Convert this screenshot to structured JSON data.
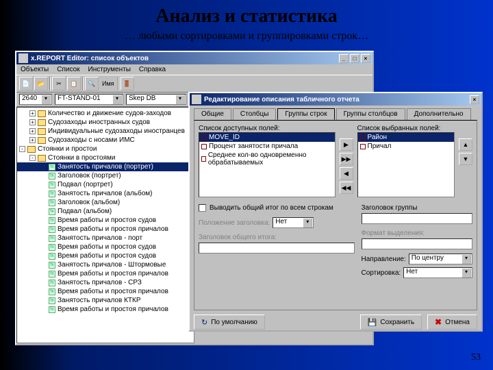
{
  "slide": {
    "title": "Анализ и статистика",
    "subtitle": "… любыми сортировками и группировками строк…",
    "page": "53"
  },
  "editor": {
    "title": "x.REPORT Editor: список объектов",
    "menu": [
      "Объекты",
      "Список",
      "Инструменты",
      "Справка"
    ],
    "filter1": "2640",
    "filter2": "FT-STAND-01",
    "filter3": "Skep DB",
    "tree": [
      {
        "ind": 1,
        "exp": "+",
        "kind": "folder",
        "label": "Количество и движение судов-заходов"
      },
      {
        "ind": 1,
        "exp": "+",
        "kind": "folder",
        "label": "Судозаходы иностранных судов"
      },
      {
        "ind": 1,
        "exp": "+",
        "kind": "folder",
        "label": "Индивидуальные судозаходы иностранцев"
      },
      {
        "ind": 1,
        "exp": "+",
        "kind": "folder",
        "label": "Судозаходы с носами ИМС"
      },
      {
        "ind": 0,
        "exp": "-",
        "kind": "folder",
        "label": "Стоянки и простои"
      },
      {
        "ind": 1,
        "exp": "-",
        "kind": "folder",
        "label": "Стоянки в простоями"
      },
      {
        "ind": 2,
        "exp": "",
        "kind": "rpt",
        "label": "Занятость причалов (портрет)",
        "sel": true
      },
      {
        "ind": 2,
        "exp": "",
        "kind": "rpt",
        "label": "Заголовок (портрет)"
      },
      {
        "ind": 2,
        "exp": "",
        "kind": "rpt",
        "label": "Подвал (портрет)"
      },
      {
        "ind": 2,
        "exp": "",
        "kind": "rpt",
        "label": "Занятость причалов (альбом)"
      },
      {
        "ind": 2,
        "exp": "",
        "kind": "rpt",
        "label": "Заголовок (альбом)"
      },
      {
        "ind": 2,
        "exp": "",
        "kind": "rpt",
        "label": "Подвал (альбом)"
      },
      {
        "ind": 2,
        "exp": "",
        "kind": "rpt",
        "label": "Время работы и простоя судов"
      },
      {
        "ind": 2,
        "exp": "",
        "kind": "rpt",
        "label": "Время работы и простоя причалов"
      },
      {
        "ind": 2,
        "exp": "",
        "kind": "rpt",
        "label": "Занятость причалов - порт"
      },
      {
        "ind": 2,
        "exp": "",
        "kind": "rpt",
        "label": "Время работы и простоя судов"
      },
      {
        "ind": 2,
        "exp": "",
        "kind": "rpt",
        "label": "Время работы и простоя судов"
      },
      {
        "ind": 2,
        "exp": "",
        "kind": "rpt",
        "label": "Занятость причалов - Штормовые"
      },
      {
        "ind": 2,
        "exp": "",
        "kind": "rpt",
        "label": "Время работы и простоя причалов"
      },
      {
        "ind": 2,
        "exp": "",
        "kind": "rpt",
        "label": "Занятость причалов - СРЗ"
      },
      {
        "ind": 2,
        "exp": "",
        "kind": "rpt",
        "label": "Время работы и простоя причалов"
      },
      {
        "ind": 2,
        "exp": "",
        "kind": "rpt",
        "label": "Занятость причалов КТКР"
      },
      {
        "ind": 2,
        "exp": "",
        "kind": "rpt",
        "label": "Время работы и простоя причалов"
      }
    ]
  },
  "dialog": {
    "title": "Редактирование описания табличного отчета",
    "tabs": [
      "Общие",
      "Столбцы",
      "Группы строк",
      "Группы столбцов",
      "Дополнительно"
    ],
    "active_tab": 2,
    "left_label": "Список доступных полей:",
    "right_label": "Список выбранных полей:",
    "avail": [
      {
        "label": "MOVE_ID",
        "sel": true
      },
      {
        "label": "Процент занятости причала"
      },
      {
        "label": "Среднее кол-во одновременно обрабатываемых"
      }
    ],
    "picked": [
      {
        "label": "Район",
        "sel": true
      },
      {
        "label": "Причал"
      }
    ],
    "chk_total": "Выводить общий итог по всем строкам",
    "group_header_lbl": "Заголовок группы",
    "itog_pos_lbl": "Положение заголовка:",
    "itog_pos_val": "Нет",
    "total_header_lbl": "Заголовок общего итога:",
    "format_lbl": "Формат выделения:",
    "dir_lbl": "Направление:",
    "dir_val": "По центру",
    "sort_lbl": "Сортировка:",
    "sort_val": "Нет",
    "btn_default": "По умолчанию",
    "btn_save": "Сохранить",
    "btn_cancel": "Отмена"
  }
}
